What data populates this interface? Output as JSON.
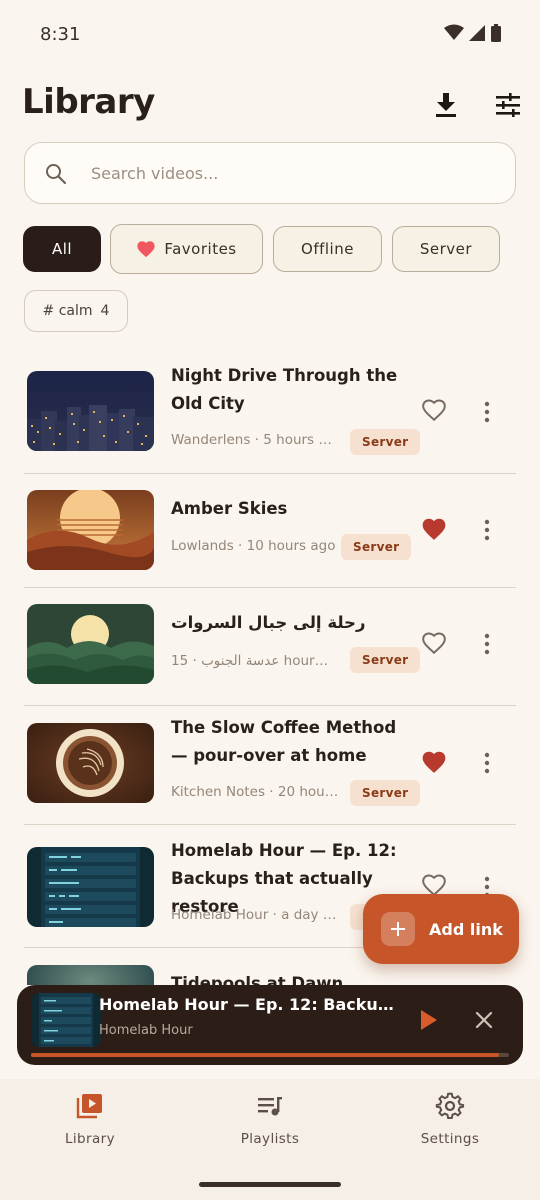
{
  "status": {
    "time": "8:31"
  },
  "header": {
    "title": "Library"
  },
  "search": {
    "placeholder": "Search videos..."
  },
  "filters": [
    {
      "label": "All",
      "active": true
    },
    {
      "label": "Favorites",
      "active": false
    },
    {
      "label": "Offline",
      "active": false
    },
    {
      "label": "Server",
      "active": false
    }
  ],
  "tag": {
    "label": "# calm",
    "count": "4"
  },
  "videos": [
    {
      "title": "Night Drive Through the Old City",
      "meta": "Wanderlens · 5 hours a...",
      "badge": "Server",
      "favorite": false
    },
    {
      "title": "Amber Skies",
      "meta": "Lowlands · 10 hours ago",
      "badge": "Server",
      "favorite": true
    },
    {
      "title": "رحلة إلى جبال السروات",
      "meta": "15 · عدسة الجنوب hours ...",
      "badge": "Server",
      "favorite": false
    },
    {
      "title": "The Slow Coffee Method — pour-over at home",
      "meta": "Kitchen Notes · 20 hour...",
      "badge": "Server",
      "favorite": true
    },
    {
      "title": "Homelab Hour — Ep. 12: Backups that actually restore",
      "meta": "Homelab Hour · a day a...",
      "badge": "Server",
      "favorite": false
    },
    {
      "title": "Tidepools at Dawn",
      "meta": "",
      "badge": "",
      "favorite": false
    }
  ],
  "fab": {
    "label": "Add link"
  },
  "player": {
    "title": "Homelab Hour — Ep. 12: Backups th...",
    "channel": "Homelab Hour",
    "progress": 0.98
  },
  "nav": [
    {
      "label": "Library",
      "active": true
    },
    {
      "label": "Playlists",
      "active": false
    },
    {
      "label": "Settings",
      "active": false
    }
  ],
  "colors": {
    "accent": "#c6562a",
    "favorite": "#b83a2e",
    "background": "#faf5ee",
    "player_bg": "#2c1d17"
  }
}
